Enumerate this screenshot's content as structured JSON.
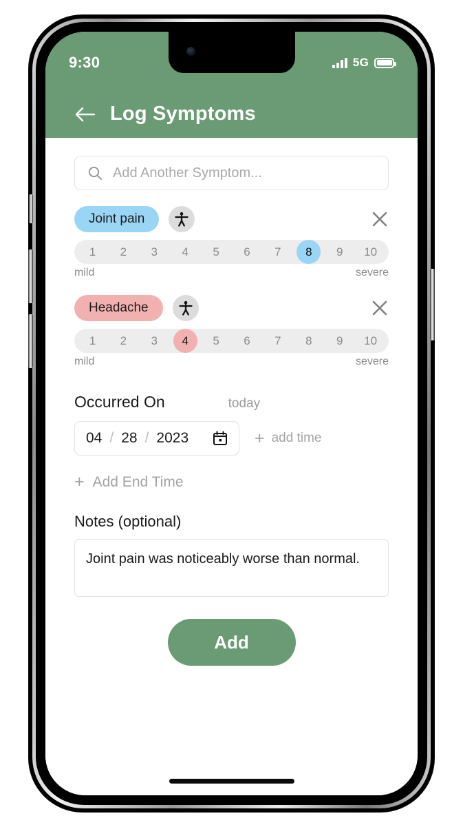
{
  "status_bar": {
    "time": "9:30",
    "network": "5G",
    "signal_icon": "signal-bars-icon",
    "battery_icon": "battery-full-icon"
  },
  "header": {
    "title": "Log Symptoms",
    "back_icon": "back-arrow-icon",
    "background_color": "#6a9b74"
  },
  "search": {
    "placeholder": "Add Another Symptom...",
    "icon": "search-icon",
    "value": ""
  },
  "scale": {
    "labels": [
      "1",
      "2",
      "3",
      "4",
      "5",
      "6",
      "7",
      "8",
      "9",
      "10"
    ],
    "low_label": "mild",
    "high_label": "severe"
  },
  "symptoms": [
    {
      "name": "Joint pain",
      "chip_color": "#9ad5f5",
      "severity": 8,
      "body_icon": "body-figure-icon",
      "remove_icon": "close-x-icon"
    },
    {
      "name": "Headache",
      "chip_color": "#f2b1b1",
      "severity": 4,
      "body_icon": "body-figure-icon",
      "remove_icon": "close-x-icon"
    }
  ],
  "occurred": {
    "label": "Occurred On",
    "today_label": "today",
    "month": "04",
    "day": "28",
    "year": "2023",
    "separator": "/",
    "calendar_icon": "calendar-icon",
    "add_time_label": "add time",
    "add_end_time_label": "Add End Time",
    "plus_icon": "plus-icon"
  },
  "notes": {
    "label": "Notes (optional)",
    "value": "Joint pain was noticeably worse than normal.",
    "placeholder": ""
  },
  "submit": {
    "label": "Add",
    "color": "#6a9b74"
  }
}
